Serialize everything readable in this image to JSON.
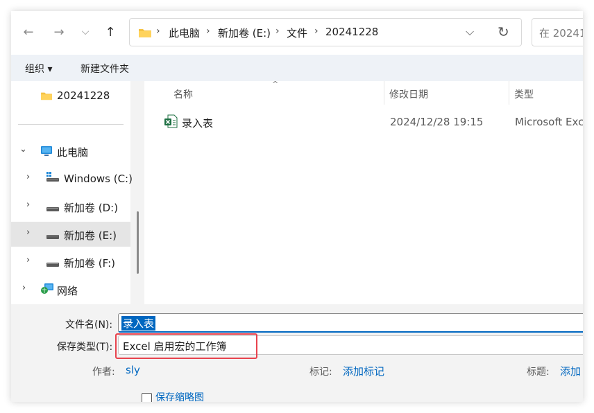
{
  "nav": {
    "back": "←",
    "forward": "→",
    "recent": "⌵",
    "up": "↑",
    "breadcrumbs": [
      "此电脑",
      "新加卷 (E:)",
      "文件",
      "20241228"
    ],
    "separator": "›",
    "dropdown": "⌵",
    "refresh": "↻",
    "search_placeholder": "在 20241"
  },
  "toolbar": {
    "organize": "组织 ▾",
    "new_folder": "新建文件夹"
  },
  "sidebar": {
    "items": [
      {
        "label": "20241228",
        "chevron": ""
      },
      {
        "label": "此电脑",
        "chevron": "⌄"
      },
      {
        "label": "Windows (C:)",
        "chevron": "›"
      },
      {
        "label": "新加卷 (D:)",
        "chevron": "›"
      },
      {
        "label": "新加卷 (E:)",
        "chevron": "›"
      },
      {
        "label": "新加卷 (F:)",
        "chevron": "›"
      },
      {
        "label": "网络",
        "chevron": "›"
      }
    ]
  },
  "filelist": {
    "columns": {
      "name": "名称",
      "modified": "修改日期",
      "type": "类型"
    },
    "sort_indicator": "^",
    "files": [
      {
        "name": "录入表",
        "modified": "2024/12/28 19:15",
        "type": "Microsoft Exc"
      }
    ]
  },
  "form": {
    "filename_label": "文件名(N):",
    "filename_value": "录入表",
    "savetype_label": "保存类型(T):",
    "savetype_value": "Excel 启用宏的工作簿",
    "author_label": "作者:",
    "author_value": "sly",
    "tags_label": "标记:",
    "tags_value": "添加标记",
    "title_label": "标题:",
    "title_value": "添加",
    "thumbnail_label": "保存缩略图"
  },
  "colors": {
    "accent": "#0067c0",
    "highlight": "#e8424d",
    "folder": "#f5c242",
    "excel": "#1d6f42"
  }
}
